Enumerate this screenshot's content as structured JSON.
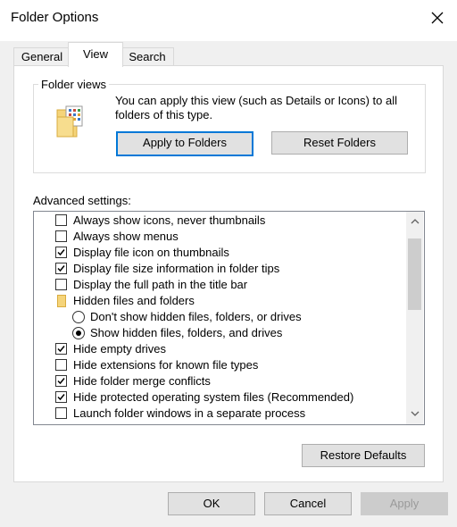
{
  "window": {
    "title": "Folder Options"
  },
  "tabs": [
    {
      "label": "General",
      "selected": false
    },
    {
      "label": "View",
      "selected": true
    },
    {
      "label": "Search",
      "selected": false
    }
  ],
  "folder_views": {
    "group_label": "Folder views",
    "description": "You can apply this view (such as Details or Icons) to all folders of this type.",
    "apply_button": "Apply to Folders",
    "reset_button": "Reset Folders"
  },
  "advanced": {
    "label": "Advanced settings:",
    "items": [
      {
        "type": "checkbox",
        "label": "Always show icons, never thumbnails",
        "checked": false
      },
      {
        "type": "checkbox",
        "label": "Always show menus",
        "checked": false
      },
      {
        "type": "checkbox",
        "label": "Display file icon on thumbnails",
        "checked": true
      },
      {
        "type": "checkbox",
        "label": "Display file size information in folder tips",
        "checked": true
      },
      {
        "type": "checkbox",
        "label": "Display the full path in the title bar",
        "checked": false
      },
      {
        "type": "folder",
        "label": "Hidden files and folders"
      },
      {
        "type": "radio",
        "label": "Don't show hidden files, folders, or drives",
        "checked": false
      },
      {
        "type": "radio",
        "label": "Show hidden files, folders, and drives",
        "checked": true
      },
      {
        "type": "checkbox",
        "label": "Hide empty drives",
        "checked": true
      },
      {
        "type": "checkbox",
        "label": "Hide extensions for known file types",
        "checked": false
      },
      {
        "type": "checkbox",
        "label": "Hide folder merge conflicts",
        "checked": true
      },
      {
        "type": "checkbox",
        "label": "Hide protected operating system files (Recommended)",
        "checked": true
      },
      {
        "type": "checkbox",
        "label": "Launch folder windows in a separate process",
        "checked": false
      }
    ]
  },
  "restore_defaults": "Restore Defaults",
  "footer": {
    "ok": "OK",
    "cancel": "Cancel",
    "apply": "Apply"
  },
  "colors": {
    "accent": "#0078d7",
    "folder": "#f5d47a"
  }
}
